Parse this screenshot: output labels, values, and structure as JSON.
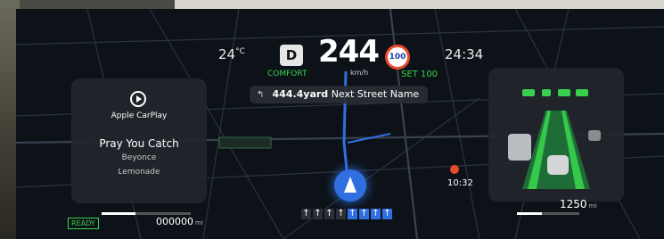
{
  "status": {
    "temperature": "24",
    "temperature_unit": "°C",
    "gear": "D",
    "drive_mode": "COMFORT",
    "speed": "244",
    "speed_unit": "km/h",
    "speed_limit": "100",
    "set_speed": "SET 100",
    "clock": "24:34"
  },
  "navigation": {
    "turn_icon": "turn-left-arrow-icon",
    "distance": "444.4yard",
    "street": "Next Street Name",
    "poi_time": "10:32",
    "lanes": [
      "↑",
      "↑",
      "↑",
      "↑",
      "↑",
      "↑",
      "↑",
      "↑"
    ],
    "active_lanes": [
      4,
      5,
      6,
      7
    ]
  },
  "media": {
    "source": "Apple CarPlay",
    "song": "Pray You Catch",
    "artist": "Beyonce",
    "album": "Lemonade"
  },
  "footer": {
    "ready": "READY",
    "odometer": "000000",
    "odometer_unit": "mi",
    "range": "1250",
    "range_unit": "mi"
  },
  "colors": {
    "accent_green": "#39d14c",
    "nav_blue": "#2f6fe0",
    "limit_red": "#e84b2c"
  }
}
